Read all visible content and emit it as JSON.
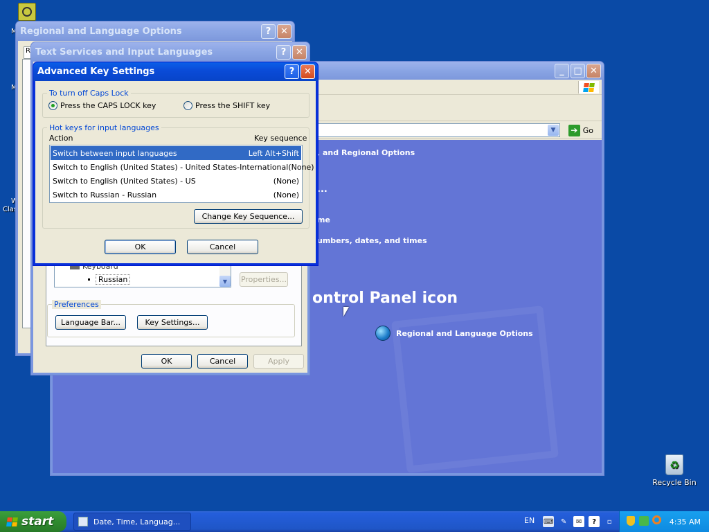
{
  "desktop": {
    "recycle_bin_label": "Recycle Bin",
    "partial_label_1": "M",
    "partial_label_2": "M",
    "partial_label_3": "W",
    "partial_label_4": "Clas"
  },
  "control_panel": {
    "address_go_label": "Go",
    "heading_partial": "ontrol Panel icon",
    "line1_partial": ", and Regional Options",
    "line2_partial": "...",
    "line3_partial": "me",
    "line4_partial": "umbers, dates, and times",
    "icon_label": "Regional and Language Options"
  },
  "regional_window": {
    "title": "Regional and Language Options"
  },
  "text_services_window": {
    "title": "Text Services and Input Languages",
    "list_item_keyboard": "Keyboard",
    "list_item_russian": "Russian",
    "properties_button": "Properties...",
    "preferences_group": "Preferences",
    "language_bar_button": "Language Bar...",
    "key_settings_button": "Key Settings...",
    "ok_button": "OK",
    "cancel_button": "Cancel",
    "apply_button": "Apply"
  },
  "advanced_dialog": {
    "title": "Advanced Key Settings",
    "caps_group_label": "To turn off Caps Lock",
    "radio_caps": "Press the CAPS LOCK key",
    "radio_shift": "Press the SHIFT key",
    "hotkeys_group_label": "Hot keys for input languages",
    "col_action": "Action",
    "col_key_sequence": "Key sequence",
    "rows": [
      {
        "action": "Switch between input languages",
        "sequence": "Left Alt+Shift"
      },
      {
        "action": "Switch to English (United States) - United States-International",
        "sequence": "(None)"
      },
      {
        "action": "Switch to English (United States) - US",
        "sequence": "(None)"
      },
      {
        "action": "Switch to Russian - Russian",
        "sequence": "(None)"
      }
    ],
    "change_key_button": "Change Key Sequence...",
    "ok_button": "OK",
    "cancel_button": "Cancel"
  },
  "taskbar": {
    "start_label": "start",
    "task_label": "Date, Time, Languag...",
    "lang_indicator": "EN",
    "clock": "4:35 AM"
  },
  "colors": {
    "desktop": "#0a4aa6",
    "title_active": "#0a5fe8",
    "selection": "#316ac5",
    "group_label": "#0046d5"
  }
}
